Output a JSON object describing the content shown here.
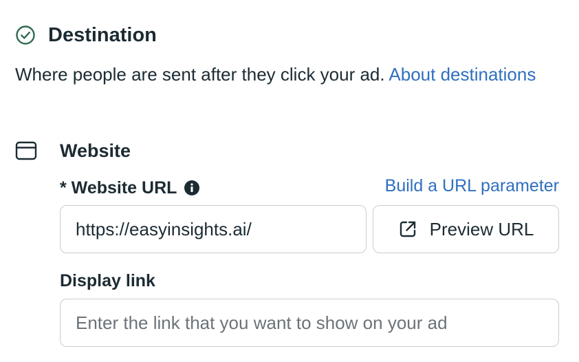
{
  "destination": {
    "icon": "check-circle-icon",
    "title": "Destination",
    "description": "Where people are sent after they click your ad.",
    "about_link": "About destinations"
  },
  "website": {
    "icon": "browser-window-icon",
    "title": "Website",
    "url_label": "* Website URL",
    "info_icon": "info-icon",
    "build_url_link": "Build a URL parameter",
    "url_value": "https://easyinsights.ai/",
    "preview_button": {
      "icon": "external-link-icon",
      "label": "Preview URL"
    },
    "display_link_label": "Display link",
    "display_link_value": "",
    "display_link_placeholder": "Enter the link that you want to show on your ad"
  },
  "colors": {
    "text": "#1c2b33",
    "link": "#2f6fbf",
    "check_green": "#2e6b4f",
    "border": "#c8ccd1",
    "placeholder": "#6b7379"
  }
}
